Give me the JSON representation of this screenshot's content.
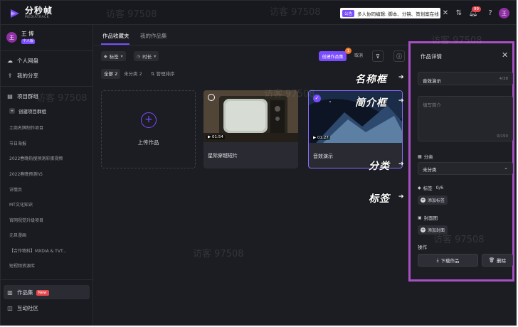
{
  "app": {
    "logo_cn": "分秒帧",
    "logo_en": "MEDIATRACK",
    "notice_tag": "公告",
    "notice_text": "多人协同编辑: 脚本、分镜、策划案在线",
    "notification_count": "99",
    "avatar_letter": "王",
    "help_label": "?"
  },
  "sidebar": {
    "user_name": "王 博",
    "user_tag": "个人版",
    "personal_disk": "个人网盘",
    "my_share": "我的分享",
    "project_group": "项目群组",
    "create_group": "创建项目群组",
    "projects": [
      "工商名牌制作项目",
      "节日海报",
      "2022春晚热搜预测彩蛋视频",
      "2022春晚预测h5",
      "详情页",
      "MT文化知识",
      "官网视觉升级项目",
      "元旦漫画",
      "【合作物料】MXDiA & TVT...",
      "短视频资源库"
    ],
    "works_collection": "作品集",
    "new_tag": "New",
    "community": "互动社区"
  },
  "main": {
    "tabs": [
      "作品收藏夹",
      "我的作品集"
    ],
    "filter_tag": "标签",
    "filter_duration": "时长",
    "create_collection": "创建作品集",
    "create_badge": "1",
    "cancel": "取消",
    "seg_all": "全部 2",
    "seg_uncategorized": "未分类 2",
    "seg_manage": "管理排序",
    "upload_text": "上传作品",
    "cards": [
      {
        "title": "星际穿越短片",
        "duration": "01:54"
      },
      {
        "title": "音效演示",
        "duration": "01:27"
      }
    ]
  },
  "annotations": {
    "name_box": "名称框",
    "intro_box": "简介框",
    "category": "分类",
    "tag": "标签"
  },
  "panel": {
    "title": "作品详情",
    "name_value": "音效演示",
    "name_count": "4/38",
    "intro_placeholder": "填写简介",
    "intro_count": "0/150",
    "category_label": "分类",
    "category_value": "未分类",
    "tag_label": "标签",
    "tag_count": "0/6",
    "add_tag": "添加标签",
    "cover_label": "封面图",
    "add_cover": "添加封面",
    "ops_label": "操作",
    "download": "下载作品",
    "delete": "删除"
  },
  "watermark": "访客 97508",
  "colors": {
    "accent": "#7a4cff",
    "highlight_border": "#a94fc4",
    "background": "#1c1d22",
    "badge_red": "#e5484d"
  }
}
